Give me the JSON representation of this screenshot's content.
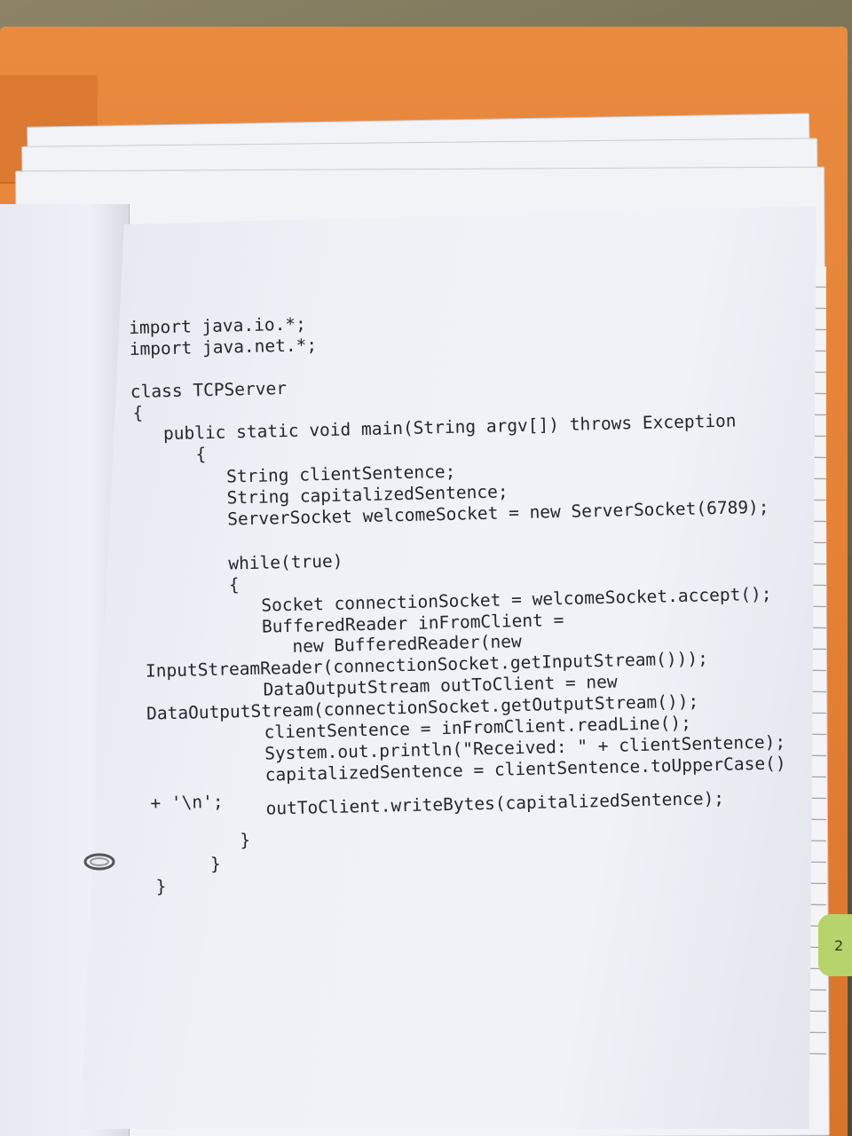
{
  "code_lines": [
    "import java.io.*;",
    "import java.net.*;",
    "class TCPServer",
    "{",
    "public static void main(String argv[]) throws Exception",
    "{",
    "String clientSentence;",
    "String capitalizedSentence;",
    "ServerSocket welcomeSocket = new ServerSocket(6789);",
    "while(true)",
    "{",
    "Socket connectionSocket = welcomeSocket.accept();",
    "BufferedReader inFromClient =",
    "new BufferedReader(new",
    "InputStreamReader(connectionSocket.getInputStream()));",
    "DataOutputStream outToClient = new",
    "DataOutputStream(connectionSocket.getOutputStream());",
    "clientSentence = inFromClient.readLine();",
    "System.out.println(\"Received: \" + clientSentence);",
    "capitalizedSentence = clientSentence.toUpperCase()",
    "+ '\\n';",
    "outToClient.writeBytes(capitalizedSentence);",
    "}",
    "}",
    "}"
  ],
  "corner_label": "2"
}
